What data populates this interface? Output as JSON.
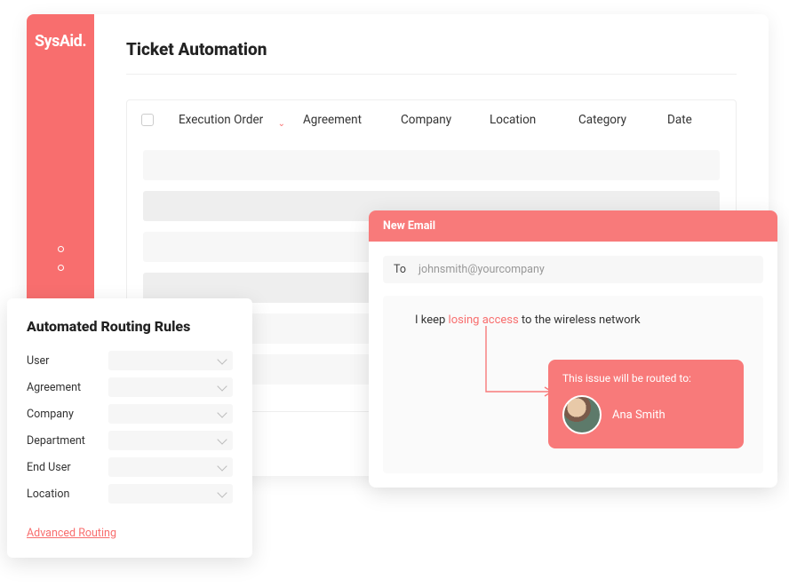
{
  "brand": {
    "name": "SysAid",
    "dot": "."
  },
  "page": {
    "title": "Ticket Automation"
  },
  "table": {
    "columns": {
      "execution_order": "Execution Order",
      "agreement": "Agreement",
      "company": "Company",
      "location": "Location",
      "category": "Category",
      "date": "Date"
    }
  },
  "routing": {
    "title": "Automated Routing Rules",
    "fields": {
      "user": "User",
      "agreement": "Agreement",
      "company": "Company",
      "department": "Department",
      "end_user": "End User",
      "location": "Location"
    },
    "advanced_link": "Advanced Routing"
  },
  "email": {
    "header": "New Email",
    "to_label": "To",
    "to_value": "johnsmith@yourcompany",
    "body_prefix": "I keep ",
    "body_highlight": "losing access",
    "body_suffix": " to the wireless network",
    "callout_title": "This issue will be routed to:",
    "agent_name": "Ana Smith"
  }
}
